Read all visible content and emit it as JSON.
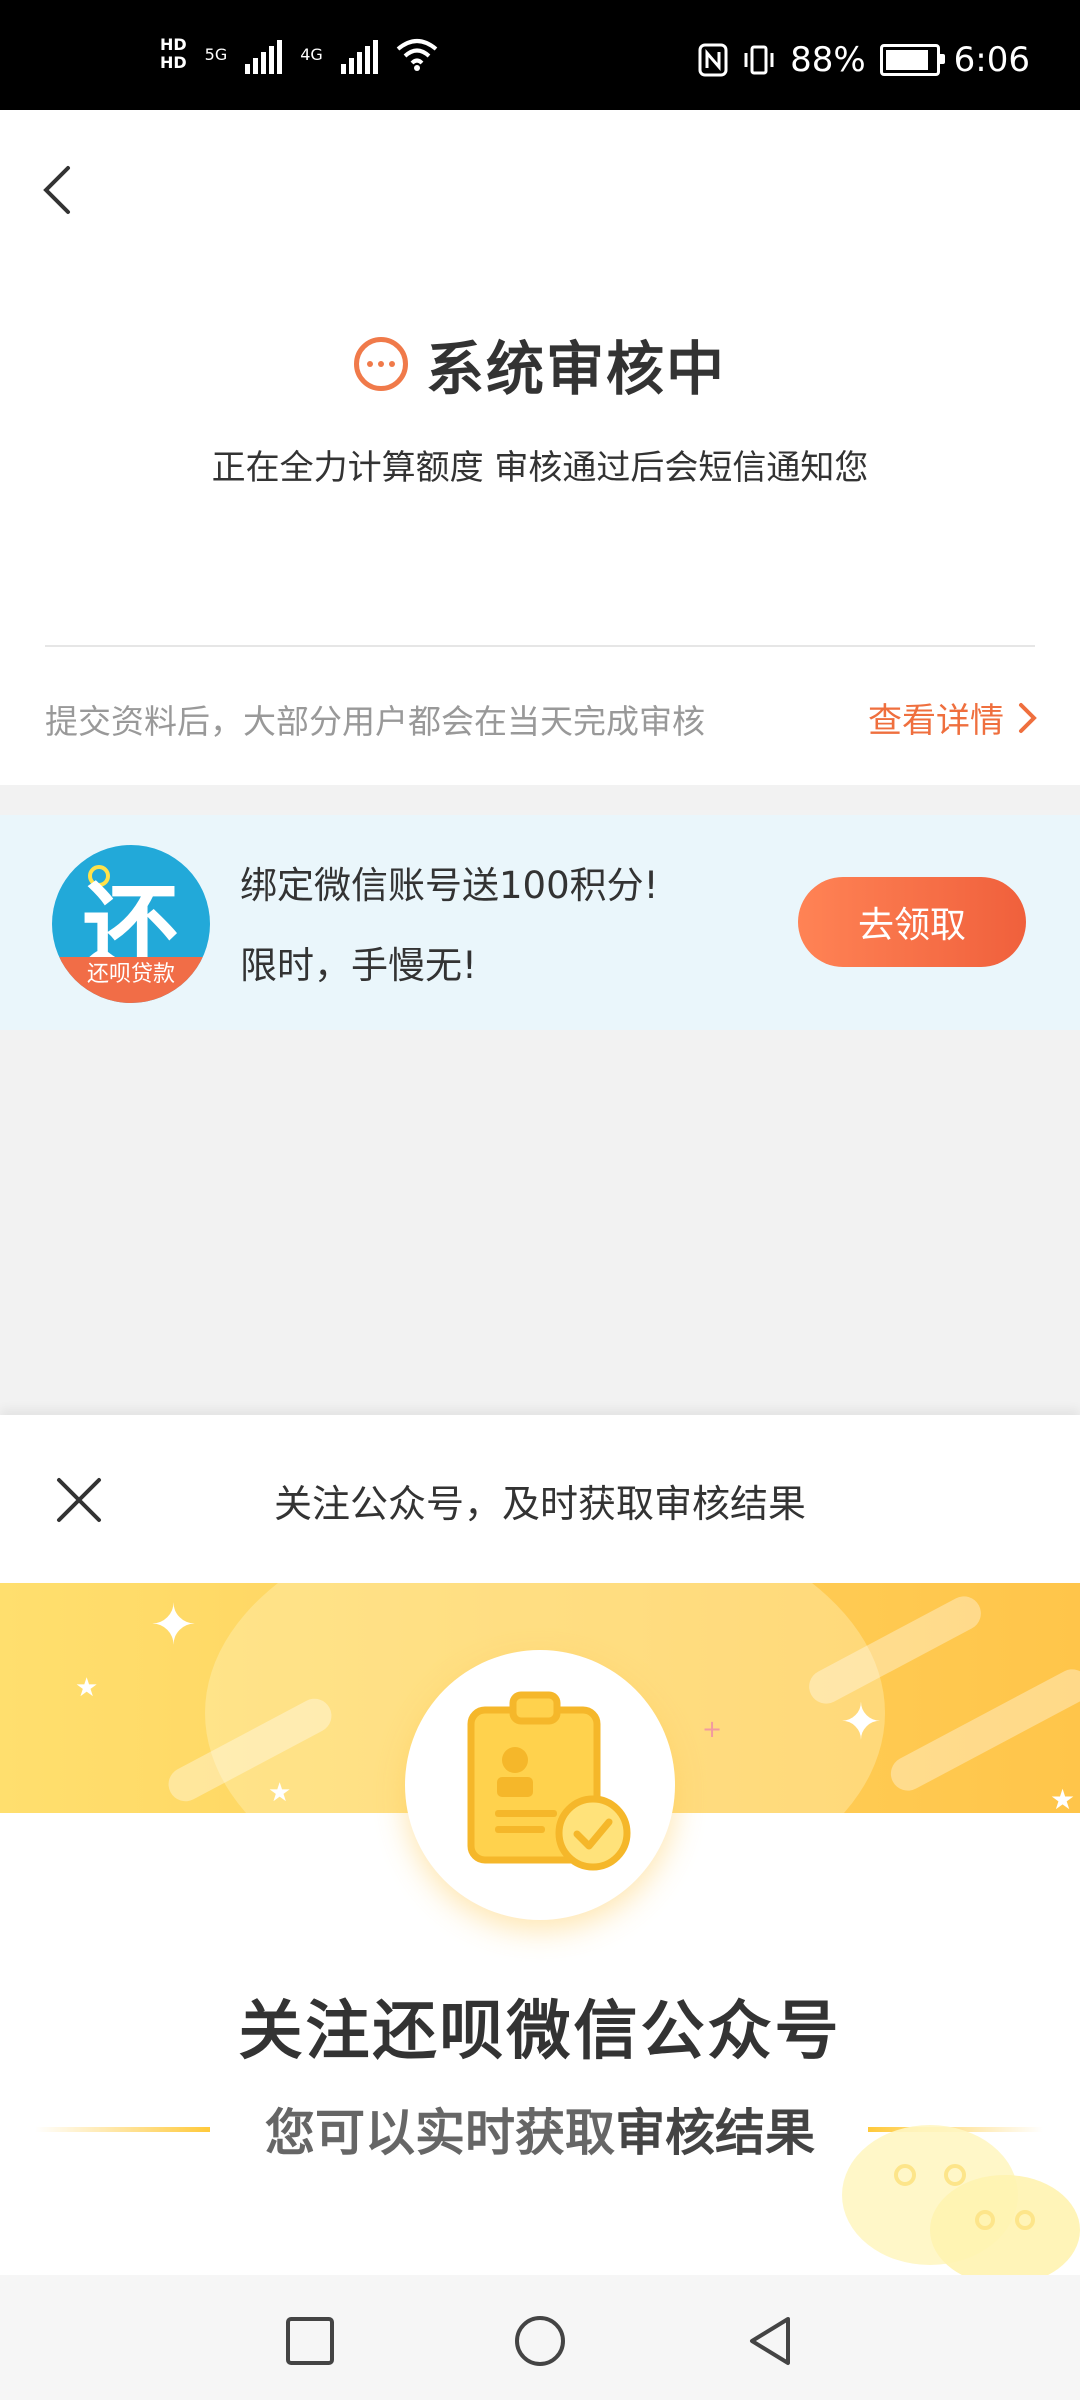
{
  "status_bar": {
    "hd1": "HD",
    "hd2": "HD",
    "net1": "5G",
    "net2": "4G",
    "battery_percent": "88%",
    "battery_level": 0.88,
    "time": "6:06"
  },
  "header": {
    "title": "系统审核中",
    "subtitle": "正在全力计算额度 审核通过后会短信通知您"
  },
  "review_note": {
    "text": "提交资料后，大部分用户都会在当天完成审核",
    "link": "查看详情"
  },
  "promo": {
    "logo_char": "还",
    "logo_brand": "还呗贷款",
    "line1": "绑定微信账号送100积分!",
    "line2": "限时，手慢无!",
    "button": "去领取"
  },
  "sheet": {
    "title": "关注公众号，及时获取审核结果",
    "heading": "关注还呗微信公众号",
    "sub_prefix": "您可以实时获取",
    "sub_highlight": "审核结果"
  },
  "colors": {
    "accent": "#ef6f3e",
    "promo_bg": "#eaf6fb",
    "logo_blue": "#22a9d9",
    "banner_yellow": "#ffd15c"
  },
  "icons": [
    "back-arrow-icon",
    "review-pending-icon",
    "chevron-right-icon",
    "close-icon",
    "clipboard-check-icon",
    "wechat-icon",
    "square-recents-icon",
    "circle-home-icon",
    "triangle-back-icon"
  ]
}
